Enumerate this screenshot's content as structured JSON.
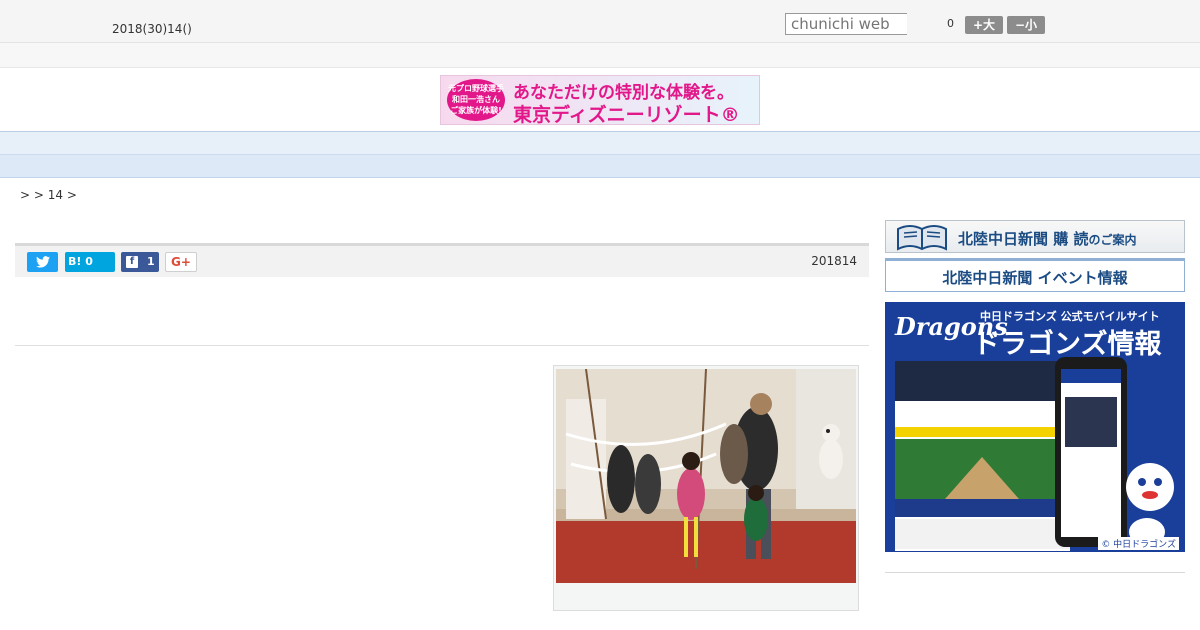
{
  "topbar": {
    "date": "2018(30)14()",
    "search_placeholder": "chunichi web",
    "counter": "0",
    "font_large": "+大",
    "font_small": "−小"
  },
  "ad": {
    "badge": "元プロ野球選手 和田一浩さん ご家族が体験!",
    "line1": "あなただけの特別な体験を。",
    "line2": "東京ディズニーリゾート®"
  },
  "nav": {
    "items": [
      "",
      "",
      "",
      "",
      "",
      "",
      "",
      "",
      ""
    ]
  },
  "breadcrumb": ">  > 14 >",
  "share": {
    "hatena_label": "B!",
    "hatena_count": "0",
    "facebook_count": "1",
    "google_label": "G+",
    "publish_date": "201814"
  },
  "sidebar": {
    "subscription_banner": "北陸中日新聞 購 読",
    "subscription_suffix": "のご案内",
    "event_banner": "北陸中日新聞 イベント情報",
    "dragons": {
      "logo": "Dragons",
      "subtitle": "中日ドラゴンズ 公式モバイルサイト",
      "title": "ドラゴンズ情報",
      "copyright": "© 中日ドラゴンズ"
    }
  },
  "colors": {
    "twitter": "#1da1f2",
    "hatena": "#00a4de",
    "facebook": "#3b5998",
    "nav_bg": "#e7eff9",
    "brand_blue": "#1b4b83"
  }
}
